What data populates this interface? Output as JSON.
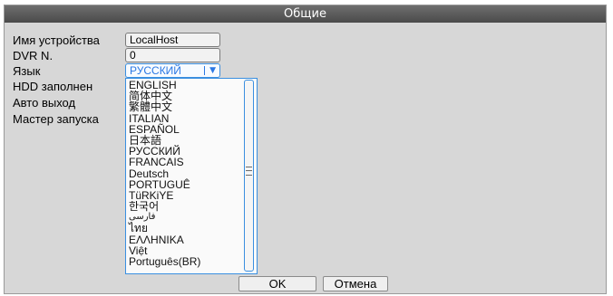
{
  "dialog": {
    "title": "Общие",
    "labels": {
      "device_name": "Имя устройства",
      "dvr_no": "DVR N.",
      "language": "Язык",
      "hdd_full": "HDD заполнен",
      "auto_logout": "Авто выход",
      "startup_wizard": "Мастер запуска"
    },
    "fields": {
      "device_name": "LocalHost",
      "dvr_no": "0",
      "language_selected": "РУССКИЙ"
    },
    "language_options": [
      "ENGLISH",
      "简体中文",
      "繁體中文",
      "ITALIAN",
      "ESPAÑOL",
      "日本語",
      "РУССКИЙ",
      "FRANCAIS",
      "Deutsch",
      "PORTUGUÊ",
      "TüRKiYE",
      "한국어",
      "فارسی",
      "ไทย",
      "ΕΛΛΗΝΙΚΑ",
      "Việt",
      "Português(BR)"
    ],
    "buttons": {
      "ok": "OK",
      "cancel": "Отмена"
    },
    "colors": {
      "accent": "#2b78e4",
      "title_bar": "#5a5a5a",
      "panel": "#d7d7d7"
    }
  }
}
